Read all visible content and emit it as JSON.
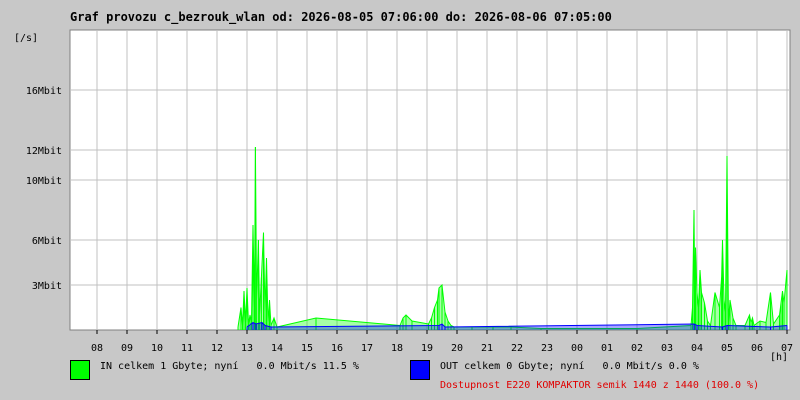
{
  "title": "Graf provozu c_bezrouk_wlan od: 2026-08-05 07:06:00 do: 2026-08-06 07:05:00",
  "legend": {
    "in_text": "IN celkem 1 Gbyte; nyní   0.0 Mbit/s 11.5 %",
    "out_text": "OUT celkem 0 Gbyte; nyní   0.0 Mbit/s 0.0 %",
    "availability": "Dostupnost E220 KOMPAKTOR semik 1440 z 1440 (100.0 %)"
  },
  "colors": {
    "background": "#c8c8c8",
    "plot_bg": "#ffffff",
    "grid": "#c0c0c0",
    "in": "#00ff00",
    "out": "#0000ff",
    "availability": "#e00000"
  },
  "chart_data": {
    "type": "area",
    "ylabel": "[/s]",
    "xlabel": "[h]",
    "ylim": [
      0,
      20
    ],
    "yticks": [
      {
        "value": 3,
        "label": "3Mbit"
      },
      {
        "value": 6,
        "label": "6Mbit"
      },
      {
        "value": 10,
        "label": "10Mbit"
      },
      {
        "value": 12,
        "label": "12Mbit"
      },
      {
        "value": 16,
        "label": "16Mbit"
      }
    ],
    "xlim": [
      7.1,
      31.1
    ],
    "xticks": [
      {
        "value": 8,
        "label": "08"
      },
      {
        "value": 9,
        "label": "09"
      },
      {
        "value": 10,
        "label": "10"
      },
      {
        "value": 11,
        "label": "11"
      },
      {
        "value": 12,
        "label": "12"
      },
      {
        "value": 13,
        "label": "13"
      },
      {
        "value": 14,
        "label": "14"
      },
      {
        "value": 15,
        "label": "15"
      },
      {
        "value": 16,
        "label": "16"
      },
      {
        "value": 17,
        "label": "17"
      },
      {
        "value": 18,
        "label": "18"
      },
      {
        "value": 19,
        "label": "19"
      },
      {
        "value": 20,
        "label": "20"
      },
      {
        "value": 21,
        "label": "21"
      },
      {
        "value": 22,
        "label": "22"
      },
      {
        "value": 23,
        "label": "23"
      },
      {
        "value": 24,
        "label": "00"
      },
      {
        "value": 25,
        "label": "01"
      },
      {
        "value": 26,
        "label": "02"
      },
      {
        "value": 27,
        "label": "03"
      },
      {
        "value": 28,
        "label": "04"
      },
      {
        "value": 29,
        "label": "05"
      },
      {
        "value": 30,
        "label": "06"
      },
      {
        "value": 31,
        "label": "07"
      }
    ],
    "grid": true,
    "series": [
      {
        "name": "IN",
        "points": [
          [
            12.7,
            0.2
          ],
          [
            12.8,
            1.5
          ],
          [
            12.85,
            0.3
          ],
          [
            12.9,
            2.6
          ],
          [
            12.95,
            0.5
          ],
          [
            13.0,
            2.8
          ],
          [
            13.05,
            0.4
          ],
          [
            13.1,
            1.0
          ],
          [
            13.15,
            0.6
          ],
          [
            13.2,
            7.0
          ],
          [
            13.25,
            1.5
          ],
          [
            13.28,
            12.2
          ],
          [
            13.32,
            2.0
          ],
          [
            13.38,
            6.0
          ],
          [
            13.42,
            1.0
          ],
          [
            13.48,
            3.5
          ],
          [
            13.55,
            6.5
          ],
          [
            13.6,
            1.2
          ],
          [
            13.65,
            4.8
          ],
          [
            13.7,
            0.5
          ],
          [
            13.75,
            2.0
          ],
          [
            13.8,
            0.3
          ],
          [
            13.9,
            0.8
          ],
          [
            14.0,
            0.2
          ],
          [
            15.3,
            0.8
          ],
          [
            18.1,
            0.3
          ],
          [
            18.2,
            0.8
          ],
          [
            18.3,
            1.0
          ],
          [
            18.5,
            0.6
          ],
          [
            19.05,
            0.4
          ],
          [
            19.15,
            0.8
          ],
          [
            19.25,
            1.5
          ],
          [
            19.35,
            2.0
          ],
          [
            19.4,
            2.8
          ],
          [
            19.5,
            3.0
          ],
          [
            19.6,
            1.2
          ],
          [
            19.7,
            0.6
          ],
          [
            19.8,
            0.3
          ],
          [
            19.9,
            0.2
          ],
          [
            20.5,
            0.2
          ],
          [
            21.2,
            0.2
          ],
          [
            21.8,
            0.2
          ],
          [
            22.8,
            0.1
          ],
          [
            26.0,
            0.1
          ],
          [
            27.8,
            0.3
          ],
          [
            27.85,
            1.5
          ],
          [
            27.9,
            8.0
          ],
          [
            27.93,
            1.2
          ],
          [
            27.95,
            5.5
          ],
          [
            28.0,
            2.5
          ],
          [
            28.05,
            1.5
          ],
          [
            28.1,
            4.0
          ],
          [
            28.15,
            2.5
          ],
          [
            28.25,
            1.8
          ],
          [
            28.35,
            0.6
          ],
          [
            28.45,
            0.3
          ],
          [
            28.6,
            2.5
          ],
          [
            28.75,
            1.5
          ],
          [
            28.82,
            3.5
          ],
          [
            28.85,
            6.0
          ],
          [
            28.9,
            2.0
          ],
          [
            28.95,
            1.2
          ],
          [
            29.0,
            11.6
          ],
          [
            29.05,
            0.5
          ],
          [
            29.1,
            2.0
          ],
          [
            29.2,
            0.8
          ],
          [
            29.3,
            0.3
          ],
          [
            29.6,
            0.3
          ],
          [
            29.75,
            1.0
          ],
          [
            29.8,
            0.5
          ],
          [
            29.85,
            0.8
          ],
          [
            29.9,
            0.3
          ],
          [
            30.1,
            0.6
          ],
          [
            30.3,
            0.5
          ],
          [
            30.45,
            2.5
          ],
          [
            30.55,
            0.4
          ],
          [
            30.75,
            1.0
          ],
          [
            30.8,
            1.8
          ],
          [
            30.85,
            2.6
          ],
          [
            30.9,
            1.8
          ],
          [
            31.0,
            4.0
          ]
        ]
      },
      {
        "name": "OUT",
        "points": [
          [
            13.0,
            0.2
          ],
          [
            13.2,
            0.5
          ],
          [
            13.3,
            0.4
          ],
          [
            13.5,
            0.5
          ],
          [
            13.6,
            0.3
          ],
          [
            13.8,
            0.2
          ],
          [
            19.4,
            0.3
          ],
          [
            19.5,
            0.4
          ],
          [
            19.6,
            0.2
          ],
          [
            27.9,
            0.4
          ],
          [
            28.0,
            0.3
          ],
          [
            28.85,
            0.2
          ],
          [
            29.0,
            0.3
          ],
          [
            30.45,
            0.2
          ],
          [
            31.0,
            0.3
          ]
        ]
      }
    ]
  }
}
